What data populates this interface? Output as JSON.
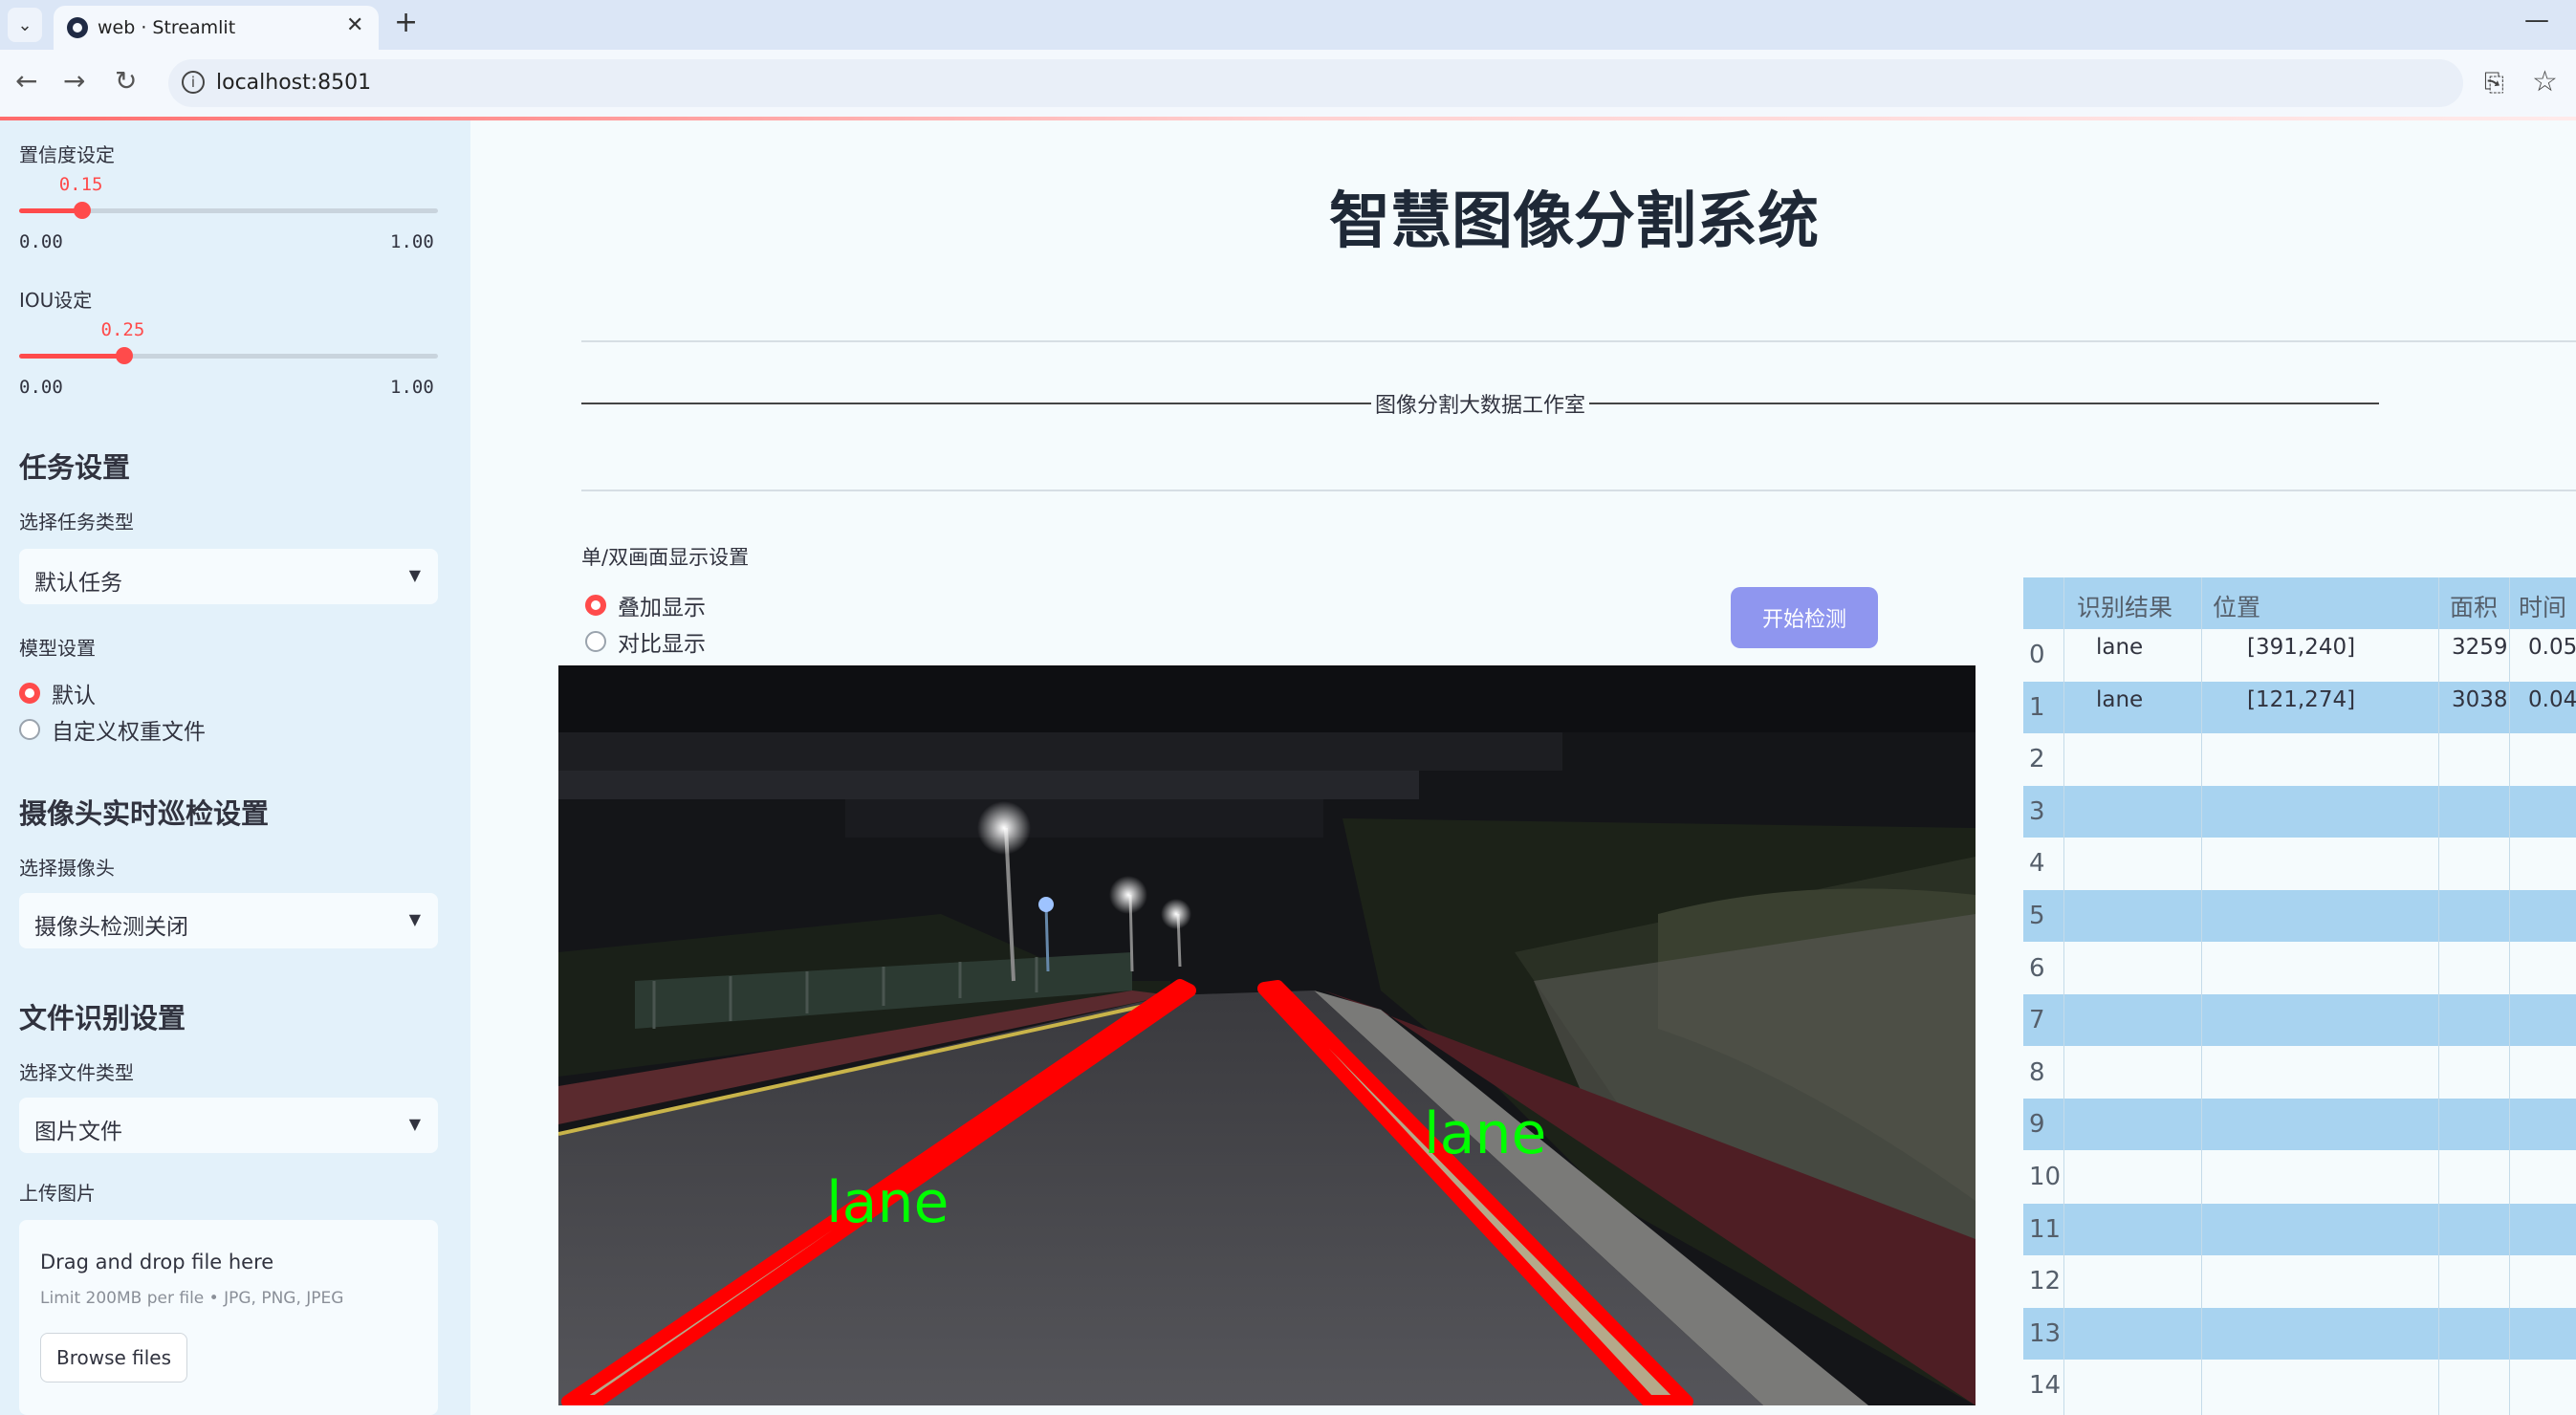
{
  "browser": {
    "tab_title": "web · Streamlit",
    "url": "localhost:8501"
  },
  "sidebar": {
    "confidence": {
      "label": "置信度设定",
      "value": "0.15",
      "min": "0.00",
      "max": "1.00",
      "level": 0.15
    },
    "iou": {
      "label": "IOU设定",
      "value": "0.25",
      "min": "0.00",
      "max": "1.00",
      "level": 0.25
    },
    "task": {
      "heading": "任务设置",
      "select_label": "选择任务类型",
      "selected": "默认任务"
    },
    "model": {
      "label": "模型设置",
      "options": [
        "默认",
        "自定义权重文件"
      ],
      "selected_index": 0
    },
    "camera": {
      "heading": "摄像头实时巡检设置",
      "select_label": "选择摄像头",
      "selected": "摄像头检测关闭"
    },
    "file": {
      "heading": "文件识别设置",
      "select_label": "选择文件类型",
      "selected": "图片文件"
    },
    "upload": {
      "label": "上传图片",
      "title": "Drag and drop file here",
      "subtitle": "Limit 200MB per file • JPG, PNG, JPEG",
      "button": "Browse files"
    }
  },
  "main": {
    "title": "智慧图像分割系统",
    "studio": "图像分割大数据工作室",
    "display_label": "单/双画面显示设置",
    "display_options": [
      "叠加显示",
      "对比显示"
    ],
    "display_selected_index": 0,
    "start_button": "开始检测",
    "image_labels": [
      "lane",
      "lane"
    ]
  },
  "table": {
    "columns": [
      "识别结果",
      "位置",
      "面积",
      "时间"
    ],
    "rows": [
      {
        "index": "0",
        "result": "lane",
        "position": "[391,240]",
        "area": "3259",
        "time": "0.05"
      },
      {
        "index": "1",
        "result": "lane",
        "position": "[121,274]",
        "area": "3038",
        "time": "0.04"
      },
      {
        "index": "2"
      },
      {
        "index": "3"
      },
      {
        "index": "4"
      },
      {
        "index": "5"
      },
      {
        "index": "6"
      },
      {
        "index": "7"
      },
      {
        "index": "8"
      },
      {
        "index": "9"
      },
      {
        "index": "10"
      },
      {
        "index": "11"
      },
      {
        "index": "12"
      },
      {
        "index": "13"
      },
      {
        "index": "14"
      }
    ]
  },
  "colors": {
    "accent": "#ff4b4b",
    "button": "#8f96ef",
    "table_header": "#a8d3f0",
    "sidebar_bg": "#e3f1fa",
    "lane_marking": "#ff0000",
    "lane_label": "#00ff00"
  },
  "icons": [
    "chevron-down-icon",
    "close-icon",
    "plus-icon",
    "back-icon",
    "forward-icon",
    "reload-icon",
    "info-icon",
    "translate-icon",
    "star-icon",
    "minimize-icon"
  ]
}
